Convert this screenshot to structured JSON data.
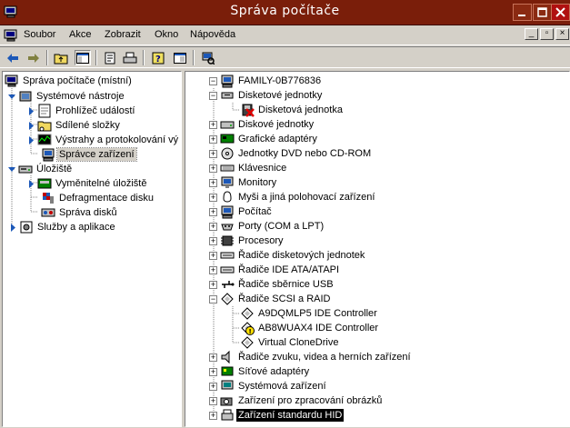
{
  "window": {
    "title": "Správa počítače"
  },
  "menu": {
    "items": [
      "Soubor",
      "Akce",
      "Zobrazit",
      "Okno",
      "Nápověda"
    ]
  },
  "colors": {
    "titlebar": "#7a1e0a",
    "selection": "#000000"
  },
  "left_tree": {
    "root": "Správa počítače (místní)",
    "items": [
      {
        "label": "Systémové nástroje",
        "icon": "tools-icon",
        "expanded": true
      },
      {
        "label": "Prohlížeč událostí",
        "icon": "event-viewer-icon"
      },
      {
        "label": "Sdílené složky",
        "icon": "shared-folder-icon"
      },
      {
        "label": "Výstrahy a protokolování vý",
        "icon": "performance-icon"
      },
      {
        "label": "Správce zařízení",
        "icon": "device-manager-icon",
        "selected": true
      },
      {
        "label": "Úložiště",
        "icon": "storage-icon",
        "expanded": true
      },
      {
        "label": "Vyměnitelné úložiště",
        "icon": "removable-storage-icon"
      },
      {
        "label": "Defragmentace disku",
        "icon": "defrag-icon"
      },
      {
        "label": "Správa disků",
        "icon": "disk-management-icon"
      },
      {
        "label": "Služby a aplikace",
        "icon": "services-icon"
      }
    ]
  },
  "device_tree": {
    "root": "FAMILY-0B776836",
    "items": [
      {
        "label": "Disketové jednotky",
        "expanded": true
      },
      {
        "label": "Disketová jednotka",
        "child": true,
        "warning": true
      },
      {
        "label": "Diskové jednotky"
      },
      {
        "label": "Grafické adaptéry"
      },
      {
        "label": "Jednotky DVD nebo CD-ROM"
      },
      {
        "label": "Klávesnice"
      },
      {
        "label": "Monitory"
      },
      {
        "label": "Myši a jiná polohovací zařízení"
      },
      {
        "label": "Počítač"
      },
      {
        "label": "Porty (COM a LPT)"
      },
      {
        "label": "Procesory"
      },
      {
        "label": "Řadiče disketových jednotek"
      },
      {
        "label": "Řadiče IDE ATA/ATAPI"
      },
      {
        "label": "Řadiče sběrnice USB"
      },
      {
        "label": "Řadiče SCSI a RAID",
        "expanded": true
      },
      {
        "label": "A9DQMLP5 IDE Controller",
        "child": true
      },
      {
        "label": "AB8WUAX4 IDE Controller",
        "child": true,
        "warning": true
      },
      {
        "label": "Virtual CloneDrive",
        "child": true
      },
      {
        "label": "Řadiče zvuku, videa a herních zařízení"
      },
      {
        "label": "Síťové adaptéry"
      },
      {
        "label": "Systémová zařízení"
      },
      {
        "label": "Zařízení pro zpracování obrázků"
      },
      {
        "label": "Zařízení standardu HID",
        "selected": true
      }
    ]
  }
}
